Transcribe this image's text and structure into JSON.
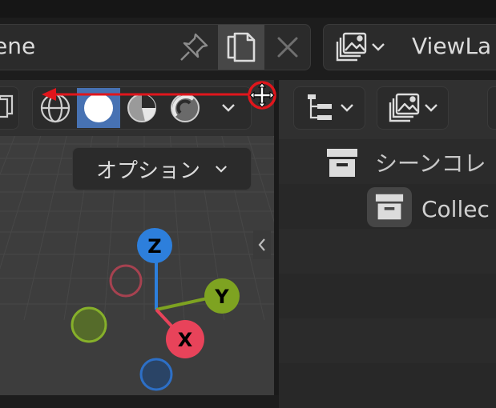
{
  "header": {
    "scene_name": "ene",
    "view_layer_name": "ViewLa",
    "icons": {
      "pin": "pin-icon",
      "copy": "copy-icon",
      "close": "close-icon",
      "view_layer": "image-stack-icon"
    }
  },
  "viewport": {
    "shading_modes": [
      "wireframe",
      "solid",
      "material-preview",
      "rendered"
    ],
    "active_shading": "solid",
    "options_label": "オプション",
    "gizmo": {
      "z_label": "Z",
      "y_label": "Y",
      "x_label": "X"
    }
  },
  "outliner": {
    "scene_collection_label": "シーンコレ",
    "collection_label": "Collec"
  },
  "colors": {
    "active_blue": "#4772b3",
    "axis_x": "#e8435a",
    "axis_y": "#7ea321",
    "axis_z": "#2d7fdc",
    "annotation_red": "#e0161c"
  }
}
